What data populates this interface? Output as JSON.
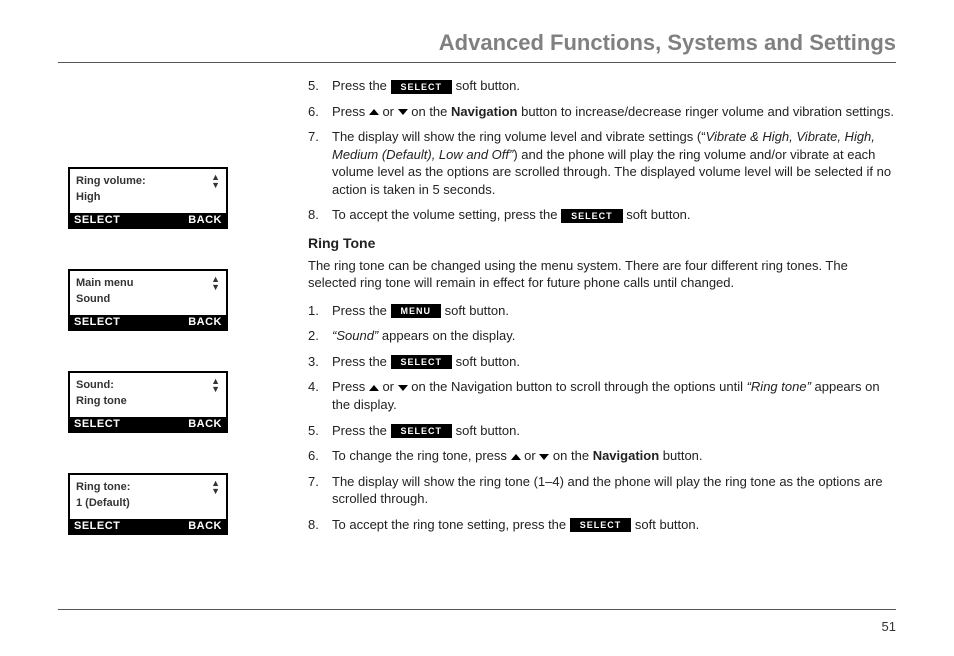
{
  "header": {
    "title": "Advanced Functions, Systems and Settings"
  },
  "page_number": "51",
  "softkey_labels": {
    "select": "SELECT",
    "menu": "MENU",
    "back": "BACK"
  },
  "screens": [
    {
      "line1": "Ring volume:",
      "line2": "High",
      "left": "SELECT",
      "right": "BACK"
    },
    {
      "line1": "Main menu",
      "line2": "Sound",
      "left": "SELECT",
      "right": "BACK"
    },
    {
      "line1": "Sound:",
      "line2": "Ring tone",
      "left": "SELECT",
      "right": "BACK"
    },
    {
      "line1": "Ring tone:",
      "line2": "1 (Default)",
      "left": "SELECT",
      "right": "BACK"
    }
  ],
  "section1": {
    "steps": [
      {
        "n": "5.",
        "pre": "Press the ",
        "btn": "SELECT",
        "post": " soft button."
      },
      {
        "n": "6.",
        "pre": "Press ",
        "mid_or": "  or  ",
        "post1": " on the ",
        "navword": "Navigation",
        "post2": " button to increase/decrease ringer volume and vibration settings."
      },
      {
        "n": "7.",
        "text_a": "The display will show the ring volume level and vibrate settings (“",
        "italic": "Vibrate & High, Vibrate, High, Medium (Default), Low and Off”",
        "text_b": ") and the phone will play the ring volume and/or vibrate at each volume level as the options are scrolled through. The displayed volume level will be selected if no action is taken in 5 seconds."
      },
      {
        "n": "8.",
        "pre": "To accept the volume setting, press the ",
        "btn": "SELECT",
        "post": " soft button."
      }
    ]
  },
  "section2": {
    "heading": "Ring Tone",
    "intro": "The ring tone can be changed using the menu system. There are four different ring tones. The selected ring tone will remain in effect for future phone calls until changed.",
    "steps": [
      {
        "n": "1.",
        "pre": "Press the ",
        "btn": "MENU",
        "post": " soft button."
      },
      {
        "n": "2.",
        "italic": "“Sound” ",
        "post": "appears on the display."
      },
      {
        "n": "3.",
        "pre": "Press the ",
        "btn": "SELECT",
        "post": " soft button."
      },
      {
        "n": "4.",
        "pre": "Press ",
        "mid_or": "  or  ",
        "post1": " on the Navigation button to scroll through the options until ",
        "italic": "“Ring tone” ",
        "post2": "appears on the display."
      },
      {
        "n": "5.",
        "pre": "Press the ",
        "btn": "SELECT",
        "post": " soft button."
      },
      {
        "n": "6.",
        "pre": "To change the ring tone, press ",
        "mid_or": "  or  ",
        "post1": " on the ",
        "navword": "Navigation",
        "post2": " button."
      },
      {
        "n": "7.",
        "text": "The display will show the ring tone (1–4) and the phone will play the ring tone as the options are scrolled through."
      },
      {
        "n": "8.",
        "pre": "To accept the ring tone setting, press the ",
        "btn": "SELECT",
        "post": " soft button."
      }
    ]
  }
}
